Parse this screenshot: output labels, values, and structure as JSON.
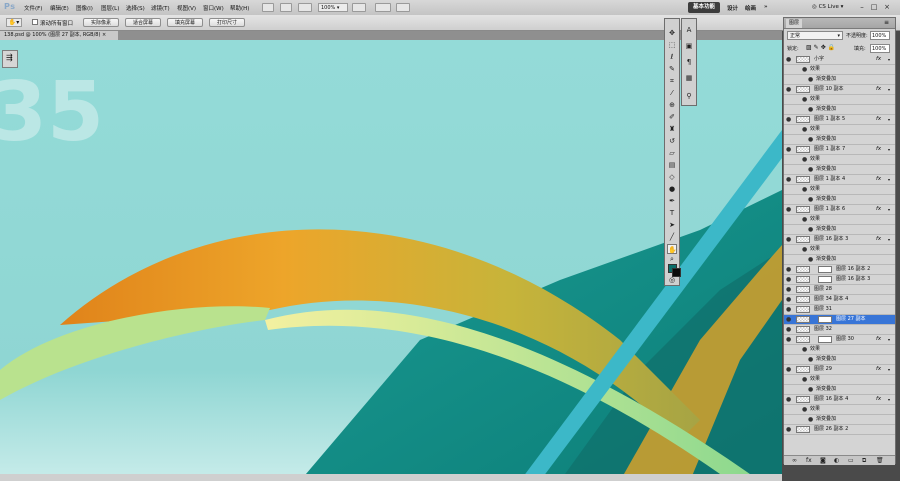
{
  "app": {
    "logo": "Ps"
  },
  "menu": [
    "文件(F)",
    "编辑(E)",
    "图像(I)",
    "图层(L)",
    "选择(S)",
    "滤镜(T)",
    "视图(V)",
    "窗口(W)",
    "帮助(H)"
  ],
  "menubar": {
    "zoom": "100%",
    "workspace_active": "基本功能",
    "workspace_links": [
      "设计",
      "绘画"
    ],
    "overflow": "»",
    "cs_live": "CS Live"
  },
  "options_bar": {
    "scroll_all_label": "滚动所有窗口",
    "buttons": [
      "实际像素",
      "适合屏幕",
      "填充屏幕",
      "打印尺寸"
    ]
  },
  "document": {
    "tab_title": "138.psd @ 100% (图层 27 副本, RGB/8) ×"
  },
  "canvas_text": "35",
  "layers_panel": {
    "tab": "图层",
    "blend_mode": "正常",
    "opacity_label": "不透明度:",
    "opacity_value": "100%",
    "lock_label": "锁定:",
    "fill_label": "填充:",
    "fill_value": "100%",
    "fx_label": "fx",
    "layers": [
      {
        "name": "小字",
        "type": "layer",
        "fx": true
      },
      {
        "name": "效果",
        "type": "effects"
      },
      {
        "name": "渐变叠加",
        "type": "effect"
      },
      {
        "name": "图层 10 副本",
        "type": "layer",
        "fx": true
      },
      {
        "name": "效果",
        "type": "effects"
      },
      {
        "name": "渐变叠加",
        "type": "effect"
      },
      {
        "name": "图层 1 副本 5",
        "type": "layer",
        "fx": true
      },
      {
        "name": "效果",
        "type": "effects"
      },
      {
        "name": "渐变叠加",
        "type": "effect"
      },
      {
        "name": "图层 1 副本 7",
        "type": "layer",
        "fx": true
      },
      {
        "name": "效果",
        "type": "effects"
      },
      {
        "name": "渐变叠加",
        "type": "effect"
      },
      {
        "name": "图层 1 副本 4",
        "type": "layer",
        "fx": true
      },
      {
        "name": "效果",
        "type": "effects"
      },
      {
        "name": "渐变叠加",
        "type": "effect"
      },
      {
        "name": "图层 1 副本 6",
        "type": "layer",
        "fx": true
      },
      {
        "name": "效果",
        "type": "effects"
      },
      {
        "name": "渐变叠加",
        "type": "effect"
      },
      {
        "name": "图层 16 副本 3",
        "type": "layer",
        "fx": true
      },
      {
        "name": "效果",
        "type": "effects"
      },
      {
        "name": "渐变叠加",
        "type": "effect"
      },
      {
        "name": "图层 16 副本 2",
        "type": "masked"
      },
      {
        "name": "图层 16 副本 3",
        "type": "masked"
      },
      {
        "name": "图层 28",
        "type": "layer"
      },
      {
        "name": "图层 34 副本 4",
        "type": "layer"
      },
      {
        "name": "图层 31",
        "type": "layer"
      },
      {
        "name": "图层 27 副本",
        "type": "masked",
        "selected": true
      },
      {
        "name": "图层 32",
        "type": "layer"
      },
      {
        "name": "图层 30",
        "type": "masked",
        "fx": true
      },
      {
        "name": "效果",
        "type": "effects"
      },
      {
        "name": "渐变叠加",
        "type": "effect"
      },
      {
        "name": "图层 29",
        "type": "layer",
        "fx": true
      },
      {
        "name": "效果",
        "type": "effects"
      },
      {
        "name": "渐变叠加",
        "type": "effect"
      },
      {
        "name": "图层 16 副本 4",
        "type": "layer",
        "fx": true
      },
      {
        "name": "效果",
        "type": "effects"
      },
      {
        "name": "渐变叠加",
        "type": "effect"
      },
      {
        "name": "图层 26 副本 2",
        "type": "layer"
      }
    ]
  },
  "colors": {
    "foreground": "#0c6e6a",
    "background": "#0b0b0b",
    "canvas_bg": "#8ed8d6",
    "selection": "#3875d7"
  }
}
